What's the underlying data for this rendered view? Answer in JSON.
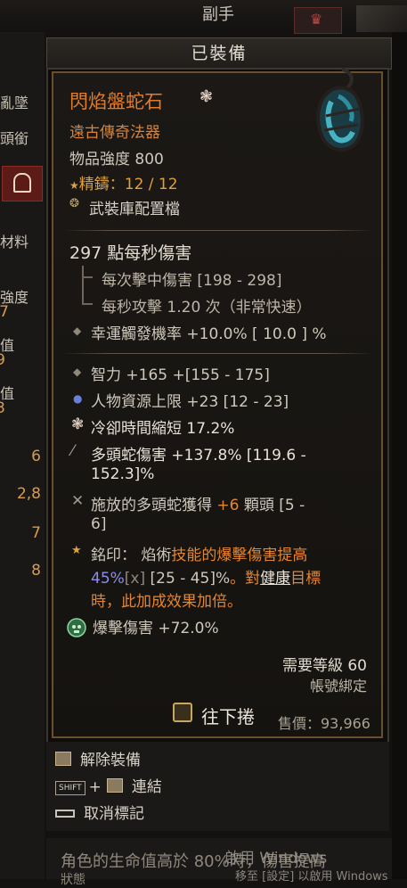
{
  "top": {
    "tab": "副手"
  },
  "left_panel": {
    "labels": [
      "亂墜",
      "頭銜",
      "材料",
      "強度",
      "值",
      "值"
    ],
    "label_nums": [
      "7",
      "9",
      "3"
    ],
    "values": [
      "6",
      "2,8",
      "7",
      "8"
    ]
  },
  "header": {
    "title": "已裝備"
  },
  "item": {
    "name": "閃焰盤蛇石",
    "rarity": "遠古傳奇法器",
    "power": "物品強度 800",
    "masterwork_label": "精鑄：",
    "masterwork_value": "12 / 12",
    "armory": "武裝庫配置檔",
    "dps": "297 點每秒傷害",
    "hit_damage": "每次擊中傷害 [198 - 298]",
    "attack_speed": "每秒攻擊 1.20 次（非常快速）",
    "lucky_hit": "幸運觸發機率 +10.0%  [ 10.0 ] %",
    "affixes": [
      {
        "text": "智力 +165 +[155 - 175]"
      },
      {
        "text": "人物資源上限 +23 [12 - 23]"
      },
      {
        "text": "冷卻時間縮短 17.2%"
      },
      {
        "line1": "多頭蛇傷害 +137.8% [119.6 -",
        "line2": "152.3]%"
      },
      {
        "line1a": "施放的多頭蛇獲得 ",
        "line1b": "+6",
        "line1c": " 顆頭 [5 -",
        "line2": "6]"
      }
    ],
    "aspect": {
      "prefix": "銘印：",
      "seg1": " 焰術",
      "seg2": "技能的爆擊傷害提高",
      "seg3": "45%",
      "seg4": "[x]",
      "seg5": " [25 - 45]%",
      "seg6": "。對",
      "seg7": "健康",
      "seg8": "目標",
      "seg9": "時，此加成效果加倍。"
    },
    "gem_socket": "爆擊傷害 +72.0%",
    "required_level": "需要等級 60",
    "account_bound": "帳號綁定",
    "scroll_hint": "往下捲",
    "price": "售價：93,966"
  },
  "actions": {
    "unequip": "解除裝備",
    "shift": "SHIFT",
    "plus": "+",
    "link": "連結",
    "unmark": "取消標記"
  },
  "footer": {
    "line1": "角色的生命值高於 80%時，傷害提高",
    "line2": "狀態"
  },
  "watermark": {
    "line1": "啟用 Windows",
    "line2": "移至 [設定] 以啟用 Windows"
  },
  "colors": {
    "legendary_orange": "#e07d2c",
    "masterwork_gold": "#e0a03a",
    "aspect_blue": "#8d8cf0",
    "frame_brown": "#6a4f2f"
  },
  "icons": [
    "gem-amulet-icon",
    "flower-icon",
    "star-icon",
    "armory-icon",
    "diamond-bullet-icon",
    "scroll-icon",
    "shift-key-icon",
    "mouse-icon",
    "spacebar-icon",
    "skull-gem-icon"
  ]
}
